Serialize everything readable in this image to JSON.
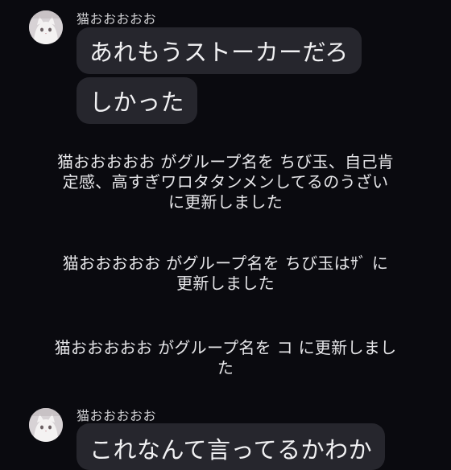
{
  "messages": [
    {
      "sender": "猫おおおおお",
      "bubbles": [
        "あれもうストーカーだろ",
        "しかった"
      ]
    }
  ],
  "system_messages": [
    "猫おおおおお がグループ名を ちび玉、自己肯定感、高すぎワロタタンメンしてるのうざい に更新しました",
    "猫おおおおお がグループ名を ちび玉はｻﾞ に更新しました",
    "猫おおおおお がグループ名を コ に更新しました"
  ],
  "message2": {
    "sender": "猫おおおおお",
    "bubble": "これなんて言ってるかわか"
  }
}
